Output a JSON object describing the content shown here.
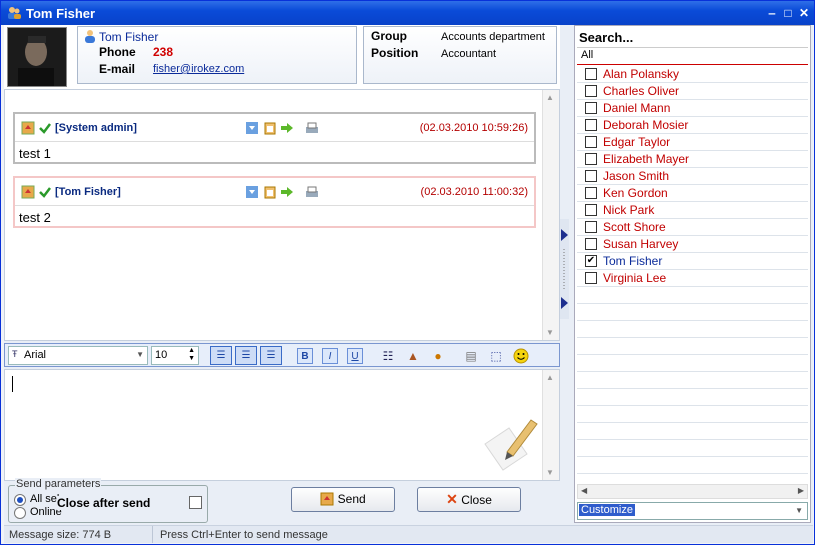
{
  "window": {
    "title": "Tom Fisher"
  },
  "contact": {
    "name": "Tom Fisher",
    "phone_label": "Phone",
    "phone": "238",
    "email_label": "E-mail",
    "email": "fisher@irokez.com",
    "group_label": "Group",
    "group": "Accounts department",
    "position_label": "Position",
    "position": "Accountant"
  },
  "messages": [
    {
      "author": "[System admin]",
      "time": "(02.03.2010 10:59:26)",
      "text": "test 1"
    },
    {
      "author": "[Tom Fisher]",
      "time": "(02.03.2010 11:00:32)",
      "text": "test 2"
    }
  ],
  "toolbar": {
    "font": "Arial",
    "size": "10",
    "bold": "B",
    "italic": "I",
    "underline": "U"
  },
  "send_params": {
    "legend": "Send parameters",
    "opt_all": "All sel",
    "opt_online": "Online",
    "close_after_send": "Close after send"
  },
  "buttons": {
    "send": "Send",
    "close": "Close"
  },
  "status": {
    "size": "Message size: 774 B",
    "hint": "Press Ctrl+Enter to send message"
  },
  "contacts": {
    "search": "Search...",
    "all": "All",
    "items": [
      {
        "name": "Alan Polansky",
        "checked": false
      },
      {
        "name": "Charles Oliver",
        "checked": false
      },
      {
        "name": "Daniel Mann",
        "checked": false
      },
      {
        "name": "Deborah Mosier",
        "checked": false
      },
      {
        "name": "Edgar Taylor",
        "checked": false
      },
      {
        "name": "Elizabeth Mayer",
        "checked": false
      },
      {
        "name": "Jason Smith",
        "checked": false
      },
      {
        "name": "Ken Gordon",
        "checked": false
      },
      {
        "name": "Nick Park",
        "checked": false
      },
      {
        "name": "Scott Shore",
        "checked": false
      },
      {
        "name": "Susan Harvey",
        "checked": false
      },
      {
        "name": "Tom Fisher",
        "checked": true
      },
      {
        "name": "Virginia Lee",
        "checked": false
      }
    ],
    "customize": "Customize"
  },
  "colors": {
    "title_bar": "#0a4bd8",
    "name_red": "#c10000",
    "link_blue": "#0b2b9a"
  }
}
